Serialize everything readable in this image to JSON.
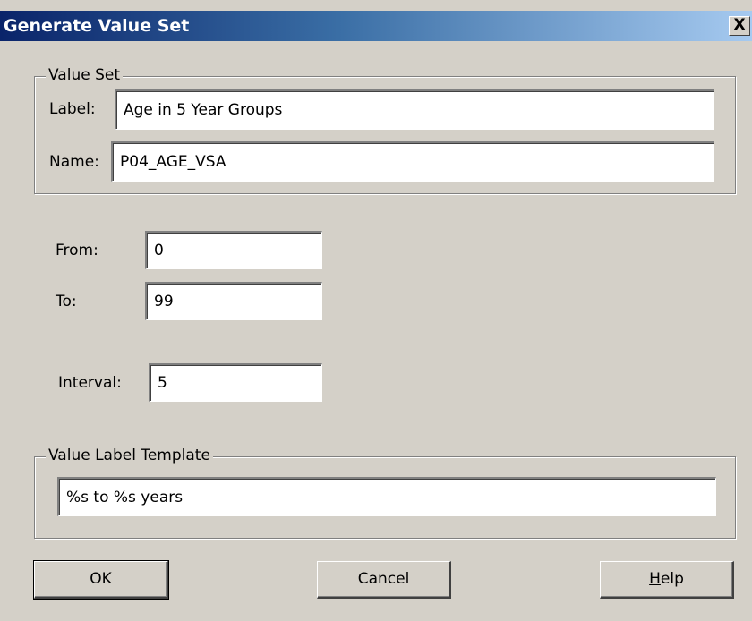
{
  "window": {
    "title": "Generate Value Set",
    "close_glyph": "X"
  },
  "value_set": {
    "group_title": "Value Set",
    "label_caption": "Label:",
    "label_value": "Age in 5 Year Groups",
    "name_caption": "Name:",
    "name_value": "P04_AGE_VSA"
  },
  "range": {
    "from_caption": "From:",
    "from_value": "0",
    "to_caption": "To:",
    "to_value": "99",
    "interval_caption": "Interval:",
    "interval_value": "5"
  },
  "template": {
    "group_title": "Value Label Template",
    "value": "%s to %s years"
  },
  "buttons": {
    "ok": "OK",
    "cancel": "Cancel",
    "help_underlined": "H",
    "help_rest": "elp"
  }
}
